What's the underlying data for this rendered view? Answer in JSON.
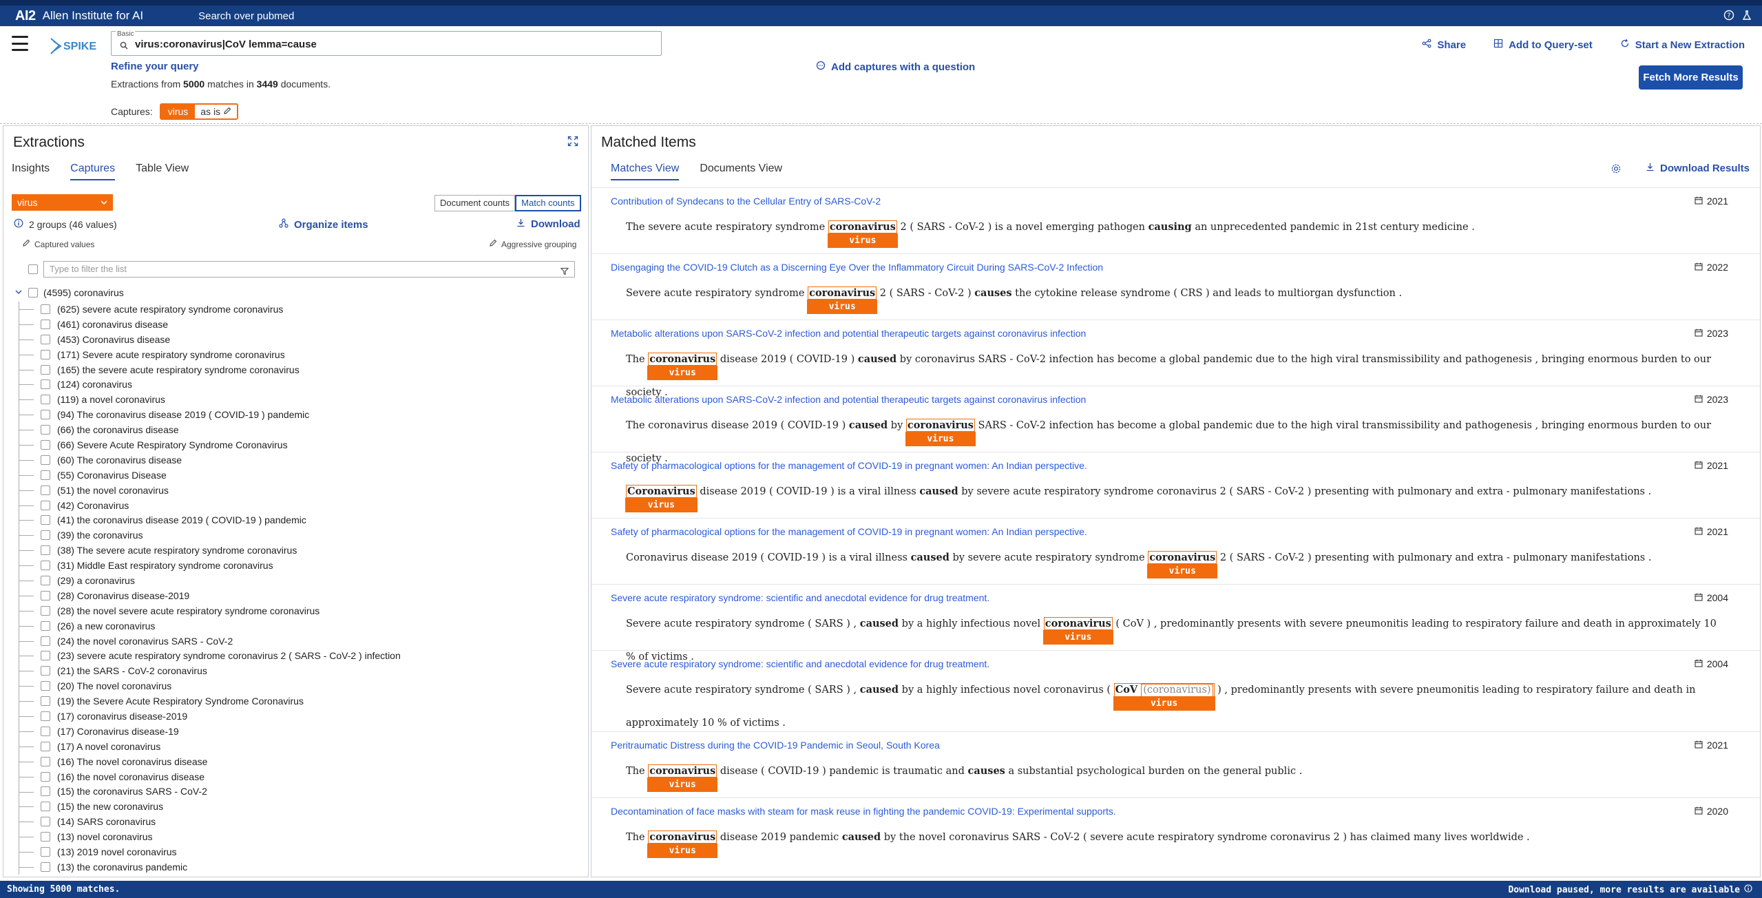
{
  "topbar": {
    "logo": "AI2",
    "org": "Allen Institute for AI",
    "search_over": "Search over pubmed",
    "icons": [
      "help-icon",
      "flask-icon"
    ]
  },
  "header": {
    "query_mode": "Basic",
    "query": "virus:coronavirus|CoV lemma=cause",
    "refine": "Refine your query",
    "summary_prefix": "Extractions from",
    "matches": "5000",
    "summary_mid": "matches in",
    "documents": "3449",
    "summary_suffix": "documents.",
    "captures_label": "Captures:",
    "capture_name": "virus",
    "capture_mode": "as is",
    "add_captures": "Add captures with a question",
    "share": "Share",
    "add_query_set": "Add to Query-set",
    "new_extraction": "Start a New Extraction",
    "fetch_more": "Fetch More Results"
  },
  "left": {
    "title": "Extractions",
    "tabs": [
      "Insights",
      "Captures",
      "Table View"
    ],
    "active_tab": "Captures",
    "capture_select": "virus",
    "count_buttons": [
      "Document counts",
      "Match counts"
    ],
    "groups": "2 groups (46 values)",
    "organize": "Organize items",
    "download": "Download",
    "captured_values": "Captured values",
    "aggressive": "Aggressive grouping",
    "filter_placeholder": "Type to filter the list",
    "root": "(4595) coronavirus",
    "items": [
      "(625) severe acute respiratory syndrome coronavirus",
      "(461) coronavirus disease",
      "(453) Coronavirus disease",
      "(171) Severe acute respiratory syndrome coronavirus",
      "(165) the severe acute respiratory syndrome coronavirus",
      "(124) coronavirus",
      "(119) a novel coronavirus",
      "(94) The coronavirus disease 2019 ( COVID-19 ) pandemic",
      "(66) the coronavirus disease",
      "(66) Severe Acute Respiratory Syndrome Coronavirus",
      "(60) The coronavirus disease",
      "(55) Coronavirus Disease",
      "(51) the novel coronavirus",
      "(42) Coronavirus",
      "(41) the coronavirus disease 2019 ( COVID-19 ) pandemic",
      "(39) the coronavirus",
      "(38) The severe acute respiratory syndrome coronavirus",
      "(31) Middle East respiratory syndrome coronavirus",
      "(29) a coronavirus",
      "(28) Coronavirus disease-2019",
      "(28) the novel severe acute respiratory syndrome coronavirus",
      "(26) a new coronavirus",
      "(24) the novel coronavirus SARS - CoV-2",
      "(23) severe acute respiratory syndrome coronavirus 2 ( SARS - CoV-2 ) infection",
      "(21) the SARS - CoV-2 coronavirus",
      "(20) The novel coronavirus",
      "(19) the Severe Acute Respiratory Syndrome Coronavirus",
      "(17) coronavirus disease-2019",
      "(17) Coronavirus disease-19",
      "(17) A novel coronavirus",
      "(16) The novel coronavirus disease",
      "(16) the novel coronavirus disease",
      "(15) the coronavirus SARS - CoV-2",
      "(15) the new coronavirus",
      "(14) SARS coronavirus",
      "(13) novel coronavirus",
      "(13) 2019 novel coronavirus",
      "(13) the coronavirus pandemic"
    ]
  },
  "right": {
    "title": "Matched Items",
    "tabs": [
      "Matches View",
      "Documents View"
    ],
    "active_tab": "Matches View",
    "download": "Download Results",
    "matches": [
      {
        "title": "Contribution of Syndecans to the Cellular Entry of SARS-CoV-2",
        "year": "2021",
        "pre": "The severe acute respiratory syndrome",
        "hit": "coronavirus",
        "mid": "2 ( SARS - CoV-2 ) is a novel emerging pathogen",
        "verb": "causing",
        "post": "an unprecedented pandemic in 21st century medicine .",
        "tag": "virus"
      },
      {
        "title": "Disengaging the COVID-19 Clutch as a Discerning Eye Over the Inflammatory Circuit During SARS-CoV-2 Infection",
        "year": "2022",
        "pre": "Severe acute respiratory syndrome",
        "hit": "coronavirus",
        "mid": "2 ( SARS - CoV-2 )",
        "verb": "causes",
        "post": "the cytokine release syndrome ( CRS ) and leads to multiorgan dysfunction .",
        "tag": "virus"
      },
      {
        "title": "Metabolic alterations upon SARS-CoV-2 infection and potential therapeutic targets against coronavirus infection",
        "year": "2023",
        "pre": "The",
        "hit": "coronavirus",
        "mid": "disease 2019 ( COVID-19 )",
        "verb": "caused",
        "post": "by coronavirus SARS - CoV-2 infection has become a global pandemic due to the high viral transmissibility and pathogenesis , bringing enormous burden to our society .",
        "tag": "virus"
      },
      {
        "title": "Metabolic alterations upon SARS-CoV-2 infection and potential therapeutic targets against coronavirus infection",
        "year": "2023",
        "pre": "The coronavirus disease 2019 ( COVID-19 )",
        "verb": "caused",
        "mid": "by",
        "hit": "coronavirus",
        "post": "SARS - CoV-2 infection has become a global pandemic due to the high viral transmissibility and pathogenesis , bringing enormous burden to our society .",
        "tag": "virus"
      },
      {
        "title": "Safety of pharmacological options for the management of COVID-19 in pregnant women: An Indian perspective.",
        "year": "2021",
        "pre": "",
        "hit": "Coronavirus",
        "mid": "disease 2019 ( COVID-19 ) is a viral illness",
        "verb": "caused",
        "post": "by severe acute respiratory syndrome coronavirus 2 ( SARS - CoV-2 ) presenting with pulmonary and extra - pulmonary manifestations .",
        "tag": "virus"
      },
      {
        "title": "Safety of pharmacological options for the management of COVID-19 in pregnant women: An Indian perspective.",
        "year": "2021",
        "pre": "Coronavirus disease 2019 ( COVID-19 ) is a viral illness",
        "verb": "caused",
        "mid": "by severe acute respiratory syndrome",
        "hit": "coronavirus",
        "post": "2 ( SARS - CoV-2 ) presenting with pulmonary and extra - pulmonary manifestations .",
        "tag": "virus"
      },
      {
        "title": "Severe acute respiratory syndrome: scientific and anecdotal evidence for drug treatment.",
        "year": "2004",
        "pre": "Severe acute respiratory syndrome ( SARS ) ,",
        "verb": "caused",
        "mid": "by a highly infectious novel",
        "hit": "coronavirus",
        "post": "( CoV ) , predominantly presents with severe pneumonitis leading to respiratory failure and death in approximately 10 % of victims .",
        "tag": "virus"
      },
      {
        "title": "Severe acute respiratory syndrome: scientific and anecdotal evidence for drug treatment.",
        "year": "2004",
        "pre": "Severe acute respiratory syndrome ( SARS ) ,",
        "verb": "caused",
        "mid": "by a highly infectious novel coronavirus (",
        "hit": "CoV",
        "hit_note": "(coronavirus)",
        "post": ") , predominantly presents with severe pneumonitis leading to respiratory failure and death in approximately 10 % of victims .",
        "tag": "virus"
      },
      {
        "title": "Peritraumatic Distress during the COVID-19 Pandemic in Seoul, South Korea",
        "year": "2021",
        "pre": "The",
        "hit": "coronavirus",
        "mid": "disease ( COVID-19 ) pandemic is traumatic and",
        "verb": "causes",
        "post": "a substantial psychological burden on the general public .",
        "tag": "virus"
      },
      {
        "title": "Decontamination of face masks with steam for mask reuse in fighting the pandemic COVID-19: Experimental supports.",
        "year": "2020",
        "pre": "The",
        "hit": "coronavirus",
        "mid": "disease 2019 pandemic",
        "verb": "caused",
        "post": "by the novel coronavirus SARS - CoV-2 ( severe acute respiratory syndrome coronavirus 2 ) has claimed many lives worldwide .",
        "tag": "virus"
      }
    ]
  },
  "footer": {
    "left": "Showing 5000 matches.",
    "right": "Download paused, more results are available"
  },
  "colors": {
    "accent": "#f26c0d",
    "brand": "#153f82",
    "link": "#2a5bd7",
    "button": "#1b4fa8"
  }
}
